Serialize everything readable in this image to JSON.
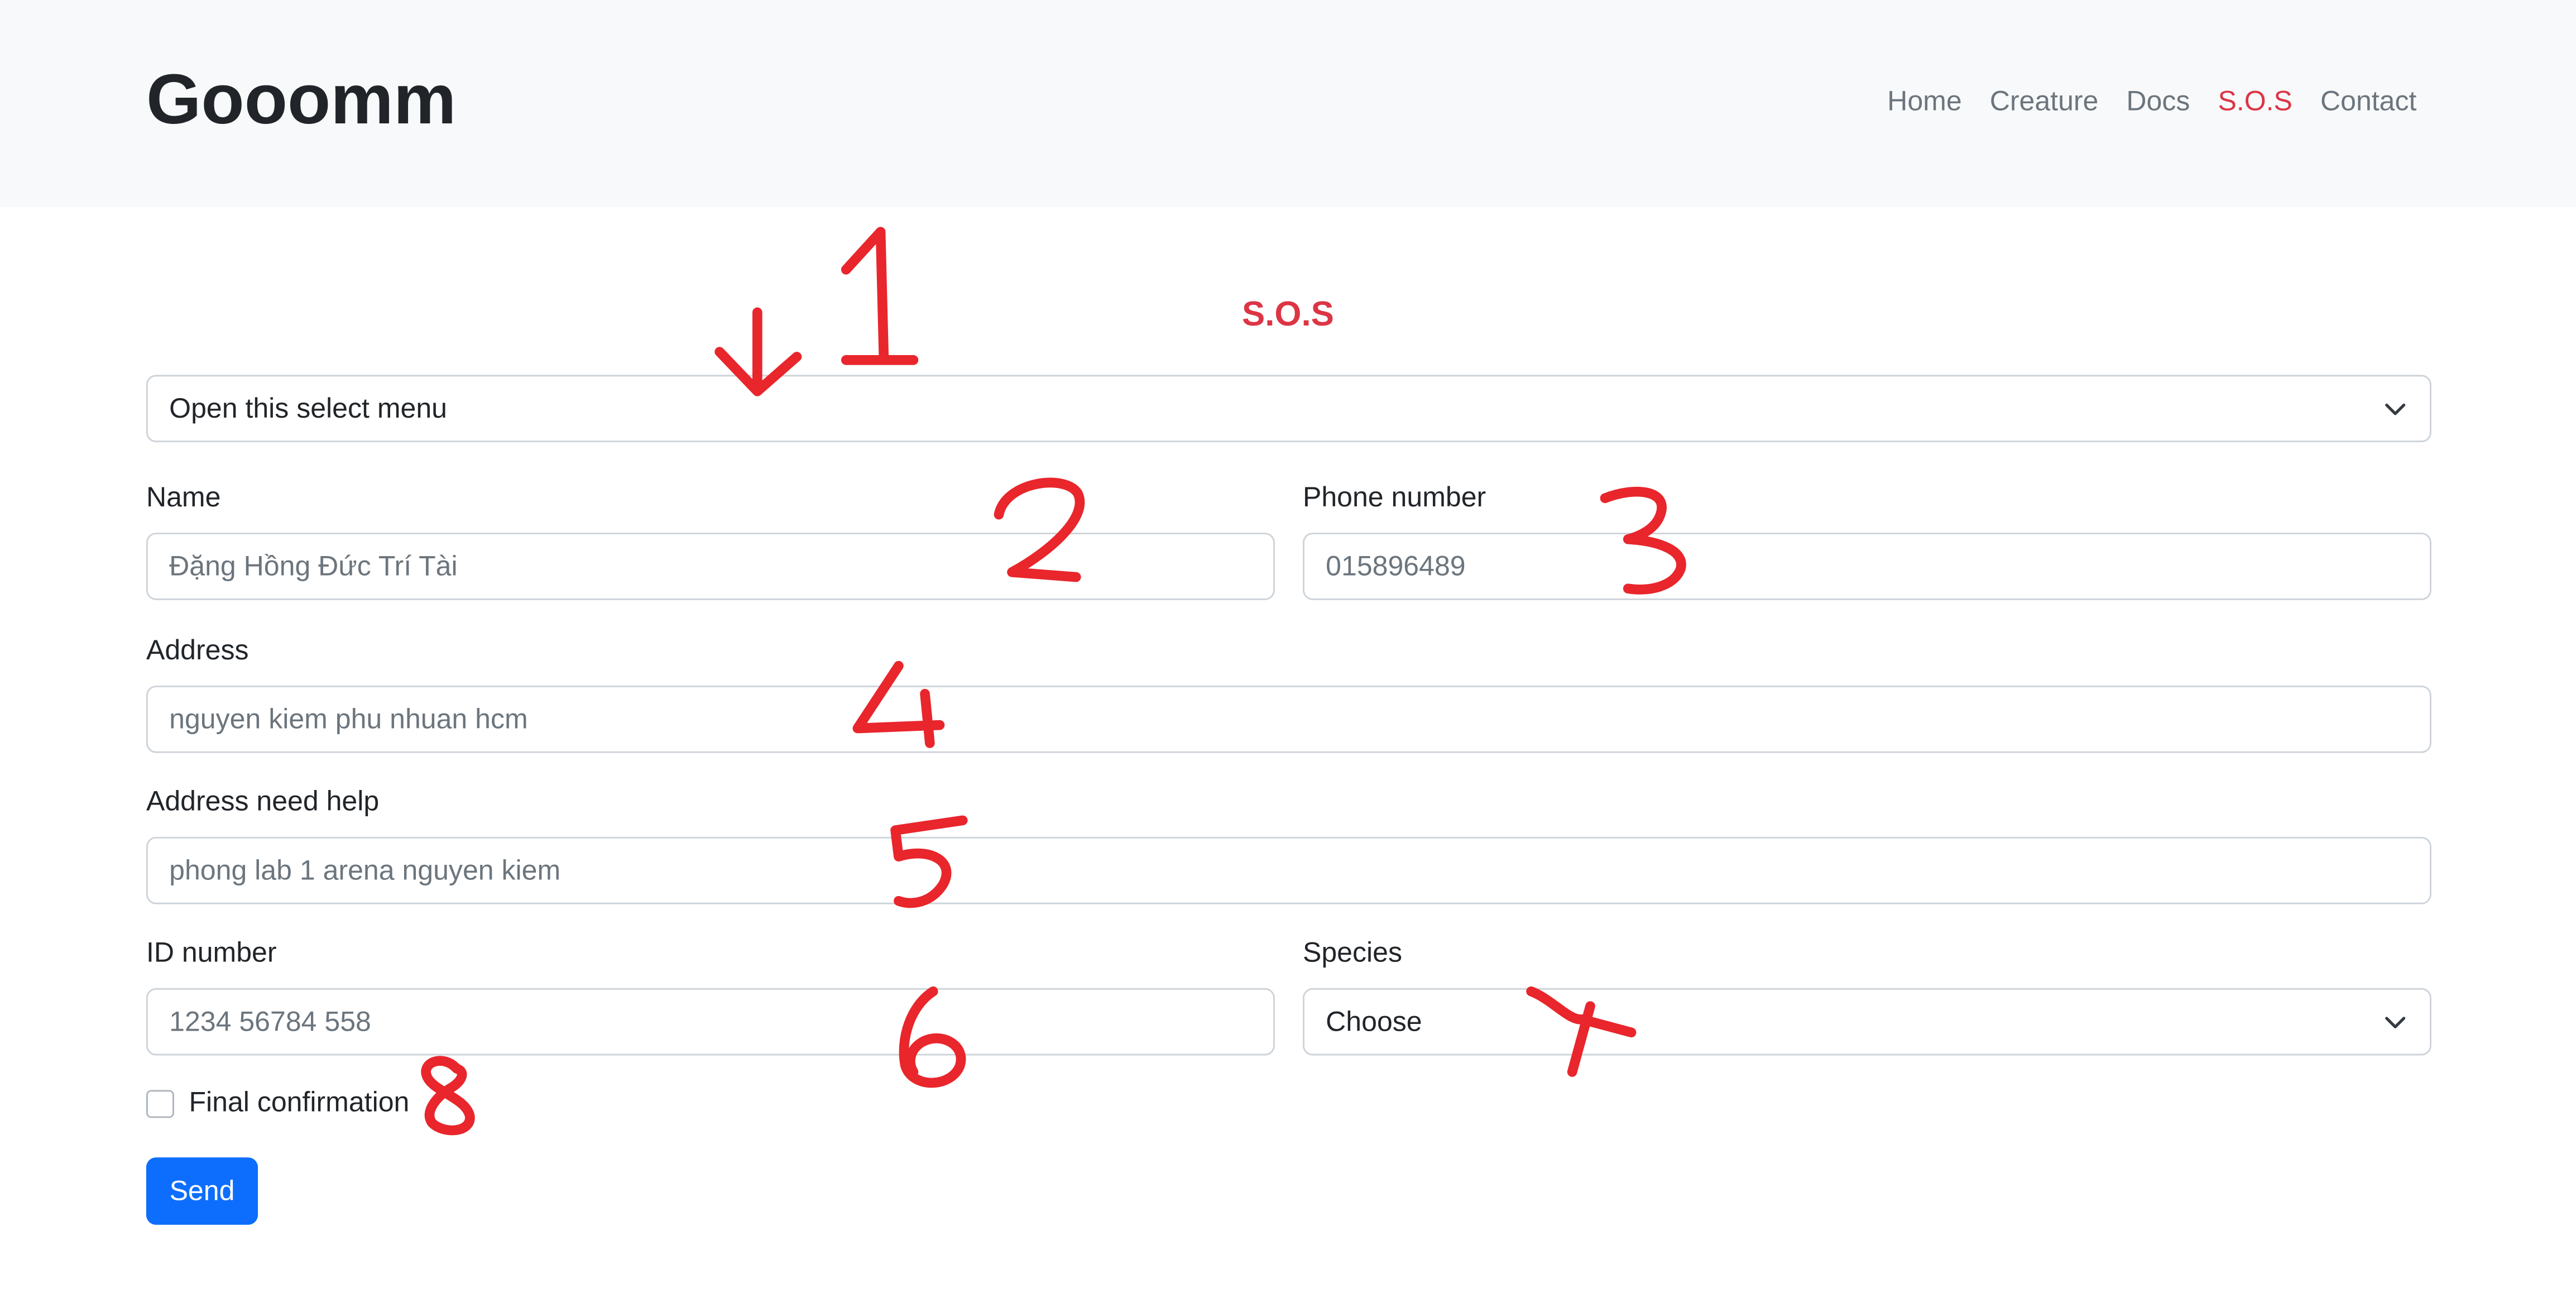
{
  "header": {
    "brand": "Gooomm",
    "nav": [
      "Home",
      "Creature",
      "Docs",
      "S.O.S",
      "Contact"
    ],
    "active_nav": "S.O.S"
  },
  "form": {
    "title": "S.O.S",
    "select_menu": {
      "value": "Open this select menu"
    },
    "name": {
      "label": "Name",
      "placeholder": "Đặng Hồng Đức Trí Tài"
    },
    "phone": {
      "label": "Phone number",
      "placeholder": "015896489"
    },
    "address": {
      "label": "Address",
      "placeholder": "nguyen kiem phu nhuan hcm"
    },
    "address_need_help": {
      "label": "Address need help",
      "placeholder": "phong lab 1 arena nguyen kiem"
    },
    "id_number": {
      "label": "ID number",
      "placeholder": "1234 56784 558"
    },
    "species": {
      "label": "Species",
      "value": "Choose"
    },
    "confirmation": {
      "label": "Final confirmation",
      "checked": false
    },
    "submit_label": "Send"
  },
  "annotations": [
    "1",
    "2",
    "3",
    "4",
    "5",
    "6",
    "7",
    "8"
  ],
  "colors": {
    "accent": "#dc3545",
    "primary": "#0d6efd",
    "annotation": "#e8262c",
    "header_bg": "#f8f9fa"
  }
}
